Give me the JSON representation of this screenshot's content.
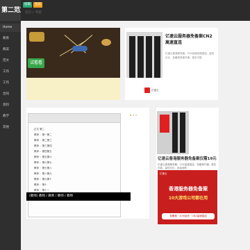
{
  "header": {
    "logo": "第二范文网",
    "tabs": [
      {
        "label": "投稿",
        "color": "#2aa876"
      },
      {
        "label": "会员",
        "color": "#f0a020"
      }
    ]
  },
  "sidebar": {
    "items": [
      {
        "label": "Home"
      },
      {
        "label": "教育"
      },
      {
        "label": "教案"
      },
      {
        "label": "范文"
      },
      {
        "label": "工作"
      },
      {
        "label": "工作"
      },
      {
        "label": "合同"
      },
      {
        "label": "资料"
      },
      {
        "label": "教学"
      },
      {
        "label": "其他"
      }
    ]
  },
  "breadcrumb": {
    "items": [
      "首页",
      "专题"
    ]
  },
  "ad_left": {
    "button": "试看看"
  },
  "ad_right": {
    "title": "亿速云服务器免备案CN2高速直连",
    "desc": "亿速云香港服务器，CN2高速线路直连，高性价比，免备案快速开通，稳定可靠",
    "brand": "亿速云"
  },
  "doc": {
    "lines": [
      "正文 第二",
      "教师 ：第一第二",
      "教师 ：第二第三",
      "教师 ：第三第四",
      "教师 ：第四第五",
      "教师 ：第五第六",
      "教师 ：第六第七",
      "教师 ：第七第八",
      "教师 ：第八第九",
      "教师 ：第九第十",
      "教师 ：第十",
      "教师 ：第十一"
    ],
    "caption": "(教师) 教师 / 教师 / 教师 / 教师"
  },
  "ad_right2": {
    "title": "亿速云香港服务器免备案仅需19元",
    "desc": "亿速云香港服务器，CN2高速直连，免备案开通，稳定可靠，高性价比，欢迎选购",
    "brand": "亿速云",
    "banner_top": "亿速云",
    "banner_main": "香港服务器免备案",
    "banner_sub": "10大游戏公司都在用",
    "banner_strip": "免备案 · 10m起步 · CN2高速直连"
  },
  "colors": {
    "topbar": "#2b2b2b",
    "sidebar": "#2f2f2f",
    "accent_green": "#2aa876",
    "accent_orange": "#f0a020",
    "brand_red": "#c81e1e"
  }
}
